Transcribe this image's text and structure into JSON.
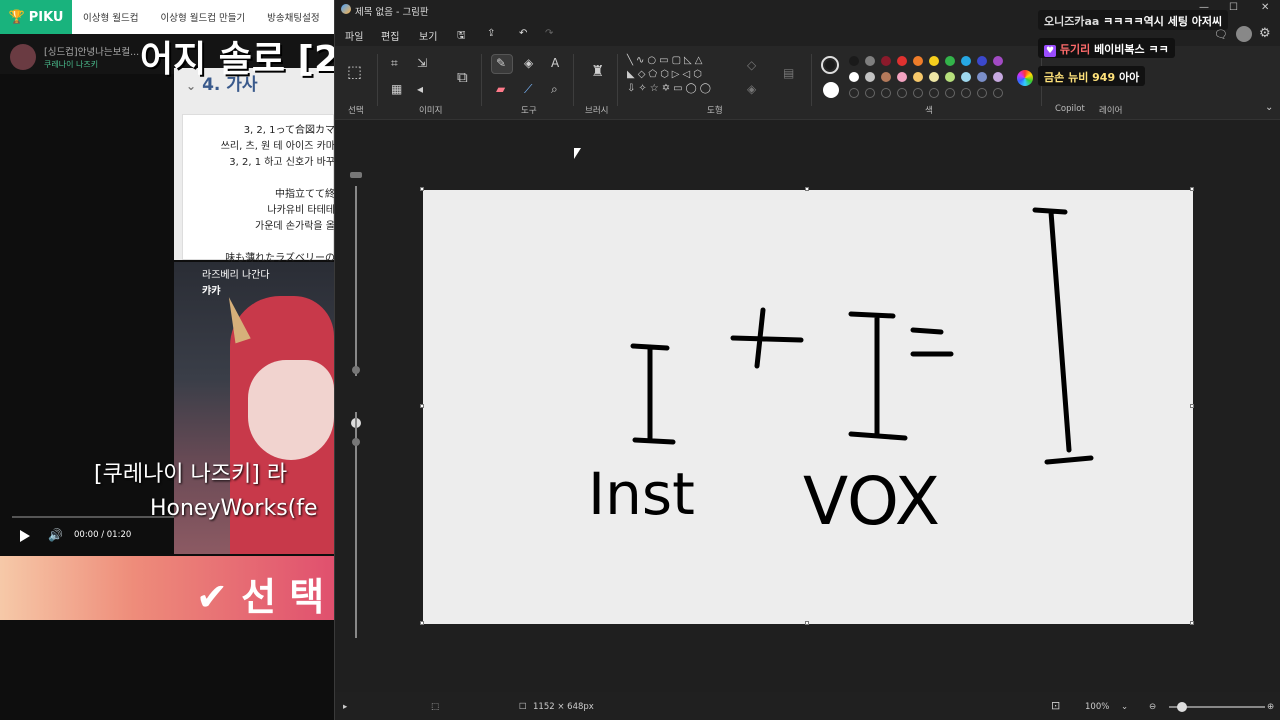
{
  "browser": {
    "brand": "PIKU",
    "tabs": [
      "이상형 월드컵",
      "이상형 월드컵 만들기",
      "방송채팅설정"
    ],
    "comment_title": "[싱드컵]안녕나는보컬...",
    "comment_meta": "쿠레나이 나즈키",
    "big_title": "어지 솔로 [2",
    "lyrics_heading": "4. 가사",
    "lyrics_lines": [
      "3, 2, 1って合図カマ",
      "쓰리, 츠, 원 테 아이즈 카마",
      "3, 2, 1 하고 신호가 바꾸",
      "",
      "中指立てて終",
      "나카유비 타테테",
      "가운데 손가락을 올",
      "",
      "味も薄れたラズベリーの"
    ],
    "video_caption_1": "라즈베리 나간다",
    "video_caption_2": "캬캬",
    "song_title": "[쿠레나이 나즈키] 라",
    "song_artist": "HoneyWorks(fe",
    "video_time": "00:00 / 01:20",
    "select_label": "✔ 선 택"
  },
  "paint": {
    "title": "제목 없음 - 그림판",
    "menu": [
      "파일",
      "편집",
      "보기"
    ],
    "groups": [
      "선택",
      "이미지",
      "도구",
      "브러시",
      "도형",
      "색",
      "Copilot",
      "레이어"
    ],
    "status_size": "1152 × 648px",
    "zoom": "100%",
    "palette_row1": [
      "#1a1a1a",
      "#7f7f7f",
      "#8b1a2b",
      "#e0312f",
      "#ef7d2a",
      "#f6cf1d",
      "#33b34a",
      "#26a7e3",
      "#3b48cc",
      "#a24bc4"
    ],
    "palette_row2": [
      "#ffffff",
      "#c3c3c3",
      "#b57a5b",
      "#f4a3c1",
      "#f7c86a",
      "#efe7a6",
      "#b7e07c",
      "#9fd9ef",
      "#7b8fc9",
      "#c7a9e0"
    ],
    "primary_color": "#1a1a1a",
    "secondary_color": "#ffffff"
  },
  "chat": [
    {
      "user": "오니즈카aa",
      "msg": "ㅋㅋㅋㅋ역시 세팅 아저씨"
    },
    {
      "user": "듀기리",
      "msg": "베이비복스 ㅋㅋ"
    },
    {
      "user": "금손 뉴비 949",
      "msg": "아아"
    }
  ],
  "canvas_text": {
    "left_word": "Inst",
    "right_word": "VOX"
  }
}
